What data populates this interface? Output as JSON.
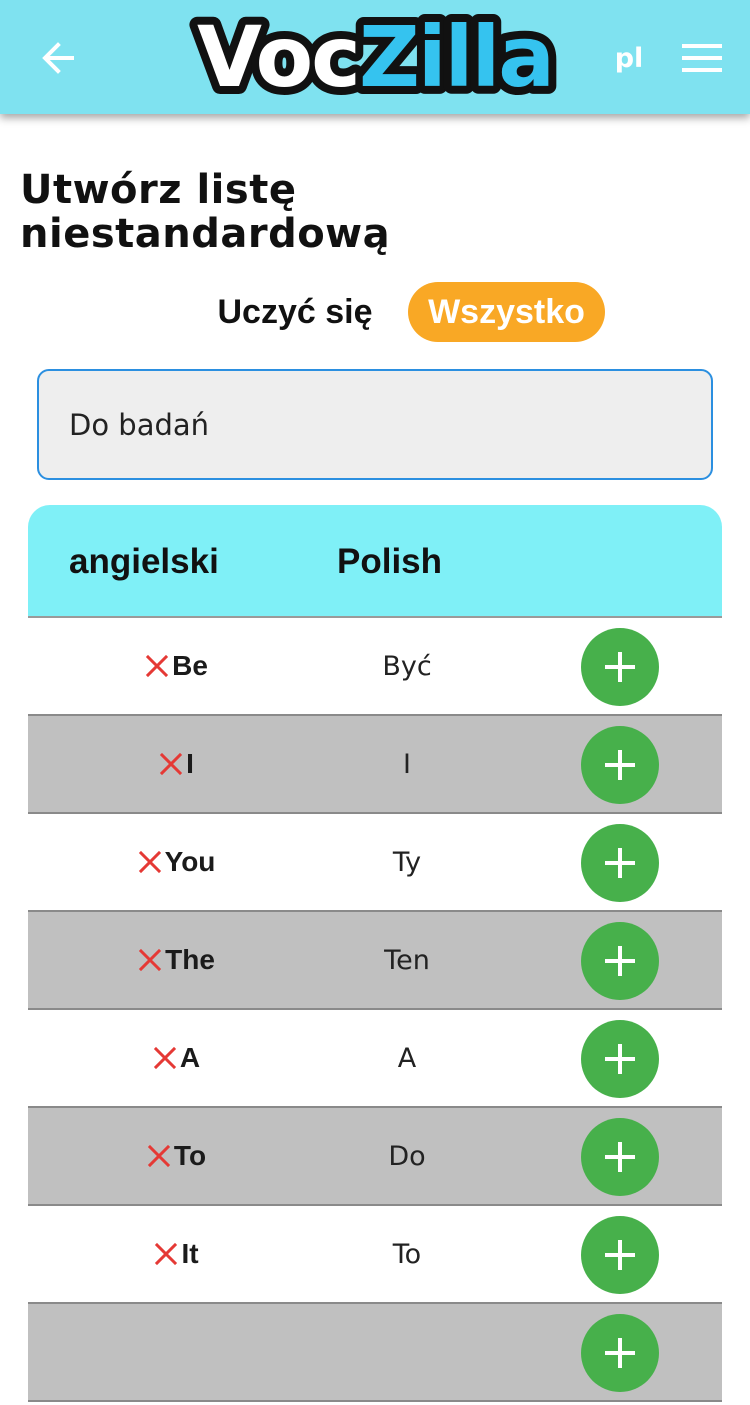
{
  "appbar": {
    "logo_part1": "Voc",
    "logo_part2": "Zilla",
    "language": "pl",
    "icons": {
      "back": "arrow-left-icon",
      "menu": "hamburger-menu-icon"
    }
  },
  "page": {
    "title_line1": "Utwórz listę",
    "title_line2": "niestandardową"
  },
  "mode": {
    "learn_label": "Uczyć się",
    "all_label": "Wszystko",
    "active": "Wszystko"
  },
  "list_name": {
    "value": "Do badań"
  },
  "table": {
    "header_en": "angielski",
    "header_pl": "Polish",
    "rows": [
      {
        "en": "Be",
        "pl": "Być"
      },
      {
        "en": "I",
        "pl": "I"
      },
      {
        "en": "You",
        "pl": "Ty"
      },
      {
        "en": "The",
        "pl": "Ten"
      },
      {
        "en": "A",
        "pl": "A"
      },
      {
        "en": "To",
        "pl": "Do"
      },
      {
        "en": "It",
        "pl": "To"
      },
      {
        "en": "",
        "pl": ""
      }
    ]
  },
  "colors": {
    "appbar": "#7fe2f0",
    "table_header": "#7ff0f7",
    "accent_orange": "#f9a825",
    "add_green": "#47b04b",
    "remove_red": "#e53935",
    "logo_blue": "#35c3ef",
    "row_gray": "#c0c0c0"
  }
}
